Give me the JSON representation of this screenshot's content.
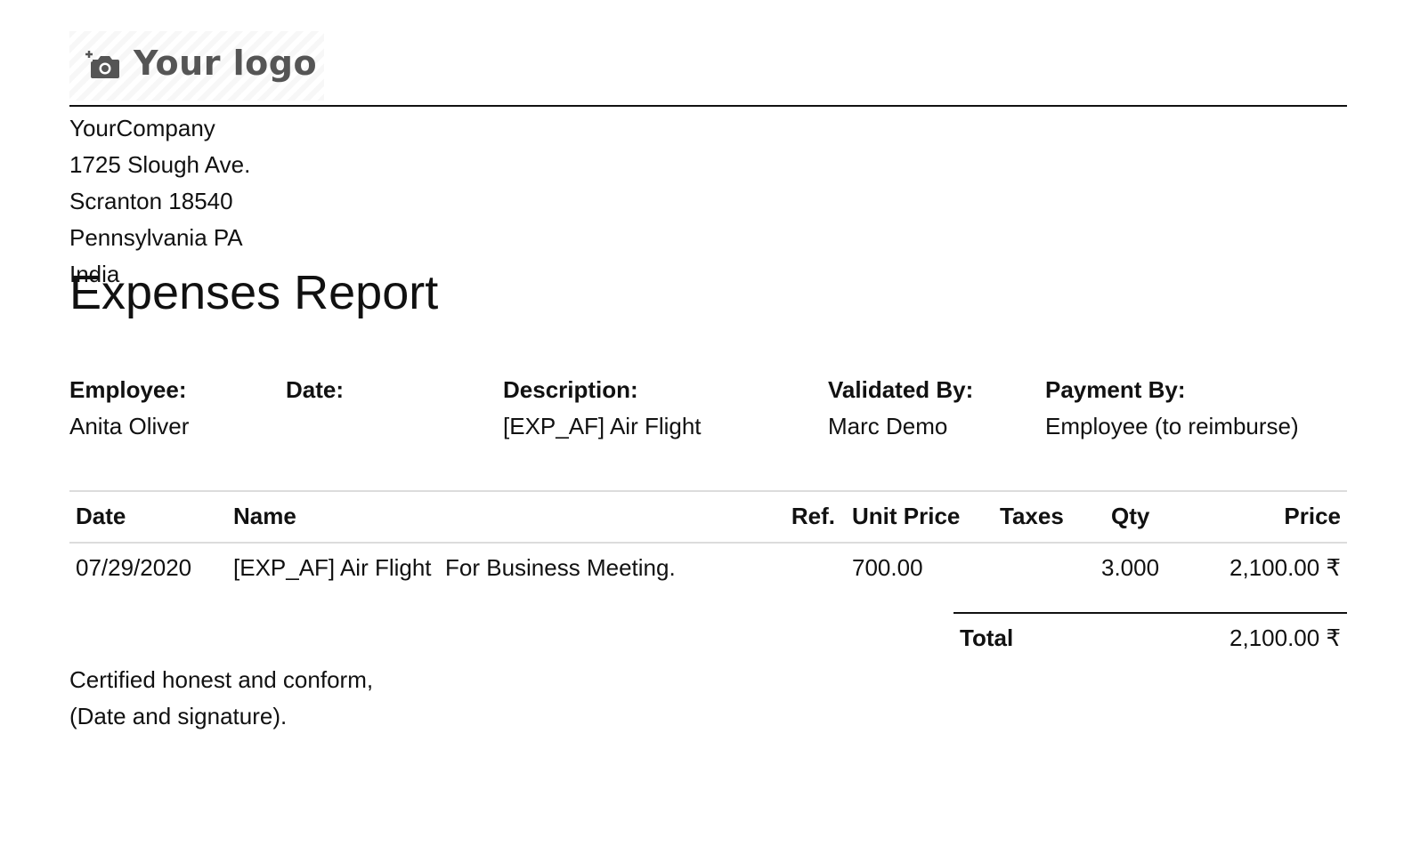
{
  "logo": {
    "text": "Your logo",
    "icon": "add-photo-camera-icon"
  },
  "company": {
    "name": "YourCompany",
    "street": "1725 Slough Ave.",
    "city_zip": "Scranton 18540",
    "state": "Pennsylvania PA",
    "country": "India"
  },
  "report": {
    "title": "Expenses Report"
  },
  "info": {
    "employee_label": "Employee:",
    "employee_value": "Anita Oliver",
    "date_label": "Date:",
    "date_value": "",
    "description_label": "Description:",
    "description_value": "[EXP_AF] Air Flight",
    "validated_label": "Validated By:",
    "validated_value": "Marc Demo",
    "payment_label": "Payment By:",
    "payment_value": "Employee (to reimburse)"
  },
  "table": {
    "headers": {
      "date": "Date",
      "name": "Name",
      "ref": "Ref.",
      "unit_price": "Unit Price",
      "taxes": "Taxes",
      "qty": "Qty",
      "price": "Price"
    },
    "rows": [
      {
        "date": "07/29/2020",
        "name": "[EXP_AF] Air Flight",
        "description": "For Business Meeting.",
        "ref": "",
        "unit_price": "700.00",
        "taxes": "",
        "qty": "3.000",
        "price": "2,100.00 ₹"
      }
    ]
  },
  "totals": {
    "label": "Total",
    "value": "2,100.00 ₹"
  },
  "certification": {
    "line1": "Certified honest and conform,",
    "line2": "(Date and signature)."
  }
}
